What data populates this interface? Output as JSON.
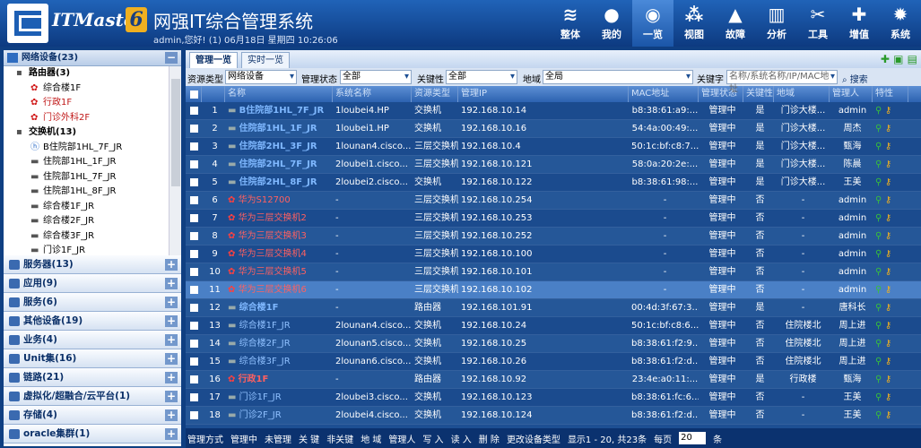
{
  "header": {
    "brand": "ITMaster",
    "brand_suffix": "6",
    "title": "网强IT综合管理系统",
    "user_info": "admin,您好! (1) 06月18日 星期四 10:26:06"
  },
  "nav": [
    {
      "label": "整体",
      "icon": "layers-icon",
      "glyph": "≋"
    },
    {
      "label": "我的",
      "icon": "user-icon",
      "glyph": "●"
    },
    {
      "label": "一览",
      "icon": "overview-icon",
      "glyph": "◉"
    },
    {
      "label": "视图",
      "icon": "topology-icon",
      "glyph": "⁂"
    },
    {
      "label": "故障",
      "icon": "warning-icon",
      "glyph": "▲"
    },
    {
      "label": "分析",
      "icon": "chart-icon",
      "glyph": "▥"
    },
    {
      "label": "工具",
      "icon": "tools-icon",
      "glyph": "✂"
    },
    {
      "label": "增值",
      "icon": "plus-icon",
      "glyph": "✚"
    },
    {
      "label": "系统",
      "icon": "gear-icon",
      "glyph": "✹"
    }
  ],
  "sidebar": {
    "header": "网络设备(23)",
    "tree": [
      {
        "label": "路由器(3)",
        "type": "group",
        "indent": 14
      },
      {
        "label": "综合楼1F",
        "type": "huawei",
        "indent": 30
      },
      {
        "label": "行政1F",
        "type": "huawei-red",
        "indent": 30
      },
      {
        "label": "门诊外科2F",
        "type": "huawei-red",
        "indent": 30
      },
      {
        "label": "交换机(13)",
        "type": "group",
        "indent": 14
      },
      {
        "label": "B住院部1HL_7F_JR",
        "type": "hp",
        "indent": 30
      },
      {
        "label": "住院部1HL_1F_JR",
        "type": "sw",
        "indent": 30
      },
      {
        "label": "住院部1HL_7F_JR",
        "type": "sw",
        "indent": 30
      },
      {
        "label": "住院部1HL_8F_JR",
        "type": "sw",
        "indent": 30
      },
      {
        "label": "综合楼1F_JR",
        "type": "sw",
        "indent": 30
      },
      {
        "label": "综合楼2F_JR",
        "type": "sw",
        "indent": 30
      },
      {
        "label": "综合楼3F_JR",
        "type": "sw",
        "indent": 30
      },
      {
        "label": "门诊1F_JR",
        "type": "sw",
        "indent": 30
      }
    ],
    "categories": [
      "服务器(13)",
      "应用(9)",
      "服务(6)",
      "其他设备(19)",
      "业务(4)",
      "Unit集(16)",
      "链路(21)",
      "虚拟化/超融合/云平台(1)",
      "存储(4)",
      "oracle集群(1)"
    ]
  },
  "tabs": [
    "管理一览",
    "实时一览"
  ],
  "filter": {
    "type_label": "资源类型",
    "type_value": "网络设备",
    "status_label": "管理状态",
    "status_value": "全部",
    "key_label": "关键性",
    "key_value": "全部",
    "region_label": "地域",
    "region_value": "全局",
    "keyword_label": "关键字",
    "keyword_placeholder": "名称/系统名称/IP/MAC地址",
    "search_label": "搜索"
  },
  "table": {
    "columns": [
      "名称",
      "系统名称",
      "资源类型",
      "管理IP",
      "MAC地址",
      "管理状态",
      "关键性",
      "地域",
      "管理人",
      "特性"
    ],
    "rows": [
      {
        "n": "1",
        "name": "B住院部1HL_7F_JR",
        "sys": "1loubei4.HP",
        "type": "交换机",
        "ip": "192.168.10.14",
        "mac": "b8:38:61:a9:...",
        "status": "管理中",
        "key": "是",
        "region": "门诊大楼...",
        "owner": "admin",
        "style": "link"
      },
      {
        "n": "2",
        "name": "住院部1HL_1F_JR",
        "sys": "1loubei1.HP",
        "type": "交换机",
        "ip": "192.168.10.16",
        "mac": "54:4a:00:49:...",
        "status": "管理中",
        "key": "是",
        "region": "门诊大楼...",
        "owner": "周杰",
        "style": "link"
      },
      {
        "n": "3",
        "name": "住院部2HL_3F_JR",
        "sys": "1lounan4.cisco...",
        "type": "三层交换机",
        "ip": "192.168.10.4",
        "mac": "50:1c:bf:c8:7...",
        "status": "管理中",
        "key": "是",
        "region": "门诊大楼...",
        "owner": "甄海",
        "style": "link"
      },
      {
        "n": "4",
        "name": "住院部2HL_7F_JR",
        "sys": "2loubei1.cisco...",
        "type": "三层交换机",
        "ip": "192.168.10.121",
        "mac": "58:0a:20:2e:...",
        "status": "管理中",
        "key": "是",
        "region": "门诊大楼...",
        "owner": "陈晨",
        "style": "link"
      },
      {
        "n": "5",
        "name": "住院部2HL_8F_JR",
        "sys": "2loubei2.cisco...",
        "type": "交换机",
        "ip": "192.168.10.122",
        "mac": "b8:38:61:98:...",
        "status": "管理中",
        "key": "是",
        "region": "门诊大楼...",
        "owner": "王美",
        "style": "link"
      },
      {
        "n": "6",
        "name": "华为S12700",
        "sys": "-",
        "type": "三层交换机",
        "ip": "192.168.10.254",
        "mac": "-",
        "status": "管理中",
        "key": "否",
        "region": "-",
        "owner": "admin",
        "style": "red"
      },
      {
        "n": "7",
        "name": "华为三层交换机2",
        "sys": "-",
        "type": "三层交换机",
        "ip": "192.168.10.253",
        "mac": "-",
        "status": "管理中",
        "key": "否",
        "region": "-",
        "owner": "admin",
        "style": "red"
      },
      {
        "n": "8",
        "name": "华为三层交换机3",
        "sys": "-",
        "type": "三层交换机",
        "ip": "192.168.10.252",
        "mac": "-",
        "status": "管理中",
        "key": "否",
        "region": "-",
        "owner": "admin",
        "style": "red"
      },
      {
        "n": "9",
        "name": "华为三层交换机4",
        "sys": "-",
        "type": "三层交换机",
        "ip": "192.168.10.100",
        "mac": "-",
        "status": "管理中",
        "key": "否",
        "region": "-",
        "owner": "admin",
        "style": "red"
      },
      {
        "n": "10",
        "name": "华为三层交换机5",
        "sys": "-",
        "type": "三层交换机",
        "ip": "192.168.10.101",
        "mac": "-",
        "status": "管理中",
        "key": "否",
        "region": "-",
        "owner": "admin",
        "style": "red"
      },
      {
        "n": "11",
        "name": "华为三层交换机6",
        "sys": "-",
        "type": "三层交换机",
        "ip": "192.168.10.102",
        "mac": "-",
        "status": "管理中",
        "key": "否",
        "region": "-",
        "owner": "admin",
        "style": "red",
        "selected": true
      },
      {
        "n": "12",
        "name": "综合楼1F",
        "sys": "-",
        "type": "路由器",
        "ip": "192.168.101.91",
        "mac": "00:4d:3f:67:3...",
        "status": "管理中",
        "key": "是",
        "region": "-",
        "owner": "唐科长",
        "style": "link"
      },
      {
        "n": "13",
        "name": "综合楼1F_JR",
        "sys": "2lounan4.cisco...",
        "type": "交换机",
        "ip": "192.168.10.24",
        "mac": "50:1c:bf:c8:6...",
        "status": "管理中",
        "key": "否",
        "region": "住院楼北",
        "owner": "周上进",
        "style": "plain"
      },
      {
        "n": "14",
        "name": "综合楼2F_JR",
        "sys": "2lounan5.cisco...",
        "type": "交换机",
        "ip": "192.168.10.25",
        "mac": "b8:38:61:f2:9...",
        "status": "管理中",
        "key": "否",
        "region": "住院楼北",
        "owner": "周上进",
        "style": "plain"
      },
      {
        "n": "15",
        "name": "综合楼3F_JR",
        "sys": "2lounan6.cisco...",
        "type": "交换机",
        "ip": "192.168.10.26",
        "mac": "b8:38:61:f2:d...",
        "status": "管理中",
        "key": "否",
        "region": "住院楼北",
        "owner": "周上进",
        "style": "plain"
      },
      {
        "n": "16",
        "name": "行政1F",
        "sys": "-",
        "type": "路由器",
        "ip": "192.168.10.92",
        "mac": "23:4e:a0:11:...",
        "status": "管理中",
        "key": "是",
        "region": "行政楼",
        "owner": "甄海",
        "style": "redbold"
      },
      {
        "n": "17",
        "name": "门诊1F_JR",
        "sys": "2loubei3.cisco...",
        "type": "交换机",
        "ip": "192.168.10.123",
        "mac": "b8:38:61:fc:6...",
        "status": "管理中",
        "key": "否",
        "region": "-",
        "owner": "王美",
        "style": "plain"
      },
      {
        "n": "18",
        "name": "门诊2F_JR",
        "sys": "2loubei4.cisco...",
        "type": "交换机",
        "ip": "192.168.10.124",
        "mac": "b8:38:61:f2:d...",
        "status": "管理中",
        "key": "否",
        "region": "-",
        "owner": "王美",
        "style": "plain"
      }
    ]
  },
  "footer": {
    "actions": [
      "管理方式",
      "管理中",
      "未管理",
      "关 键",
      "非关键",
      "地 域",
      "管理人",
      "写 入",
      "读 入",
      "删 除",
      "更改设备类型"
    ],
    "summary": "显示1 - 20, 共23条",
    "per_page_label": "每页",
    "per_page_value": "20",
    "per_page_unit": "条"
  }
}
